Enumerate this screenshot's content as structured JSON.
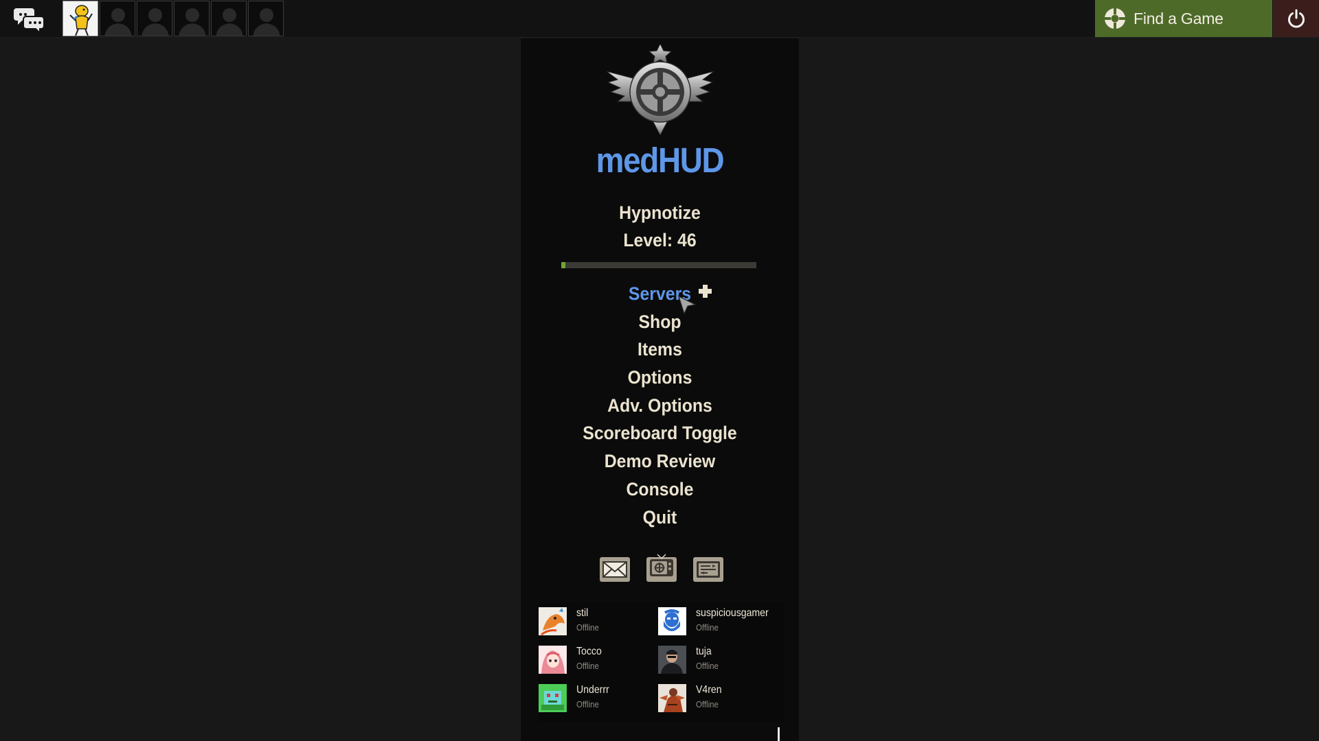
{
  "topbar": {
    "party_slots": [
      "self",
      "empty",
      "empty",
      "empty",
      "empty",
      "empty"
    ],
    "find_game_label": "Find a Game"
  },
  "menu": {
    "title": "medHUD",
    "player_name": "Hypnotize",
    "level_text": "Level: 46",
    "xp_progress": 0.02,
    "items": [
      "Servers",
      "Shop",
      "Items",
      "Options",
      "Adv. Options",
      "Scoreboard Toggle",
      "Demo Review",
      "Console",
      "Quit"
    ],
    "hovered_item": "Servers"
  },
  "bottom_icons": [
    "mail-icon",
    "tv-icon",
    "replay-icon"
  ],
  "friends": [
    {
      "name": "stil",
      "status": "Offline",
      "avatar": "orange-dragon"
    },
    {
      "name": "suspiciousgamer",
      "status": "Offline",
      "avatar": "blue-bearded-face"
    },
    {
      "name": "Tocco",
      "status": "Offline",
      "avatar": "pink-anime-girl"
    },
    {
      "name": "tuja",
      "status": "Offline",
      "avatar": "dark-soldier"
    },
    {
      "name": "Underrr",
      "status": "Offline",
      "avatar": "green-pixel-creature"
    },
    {
      "name": "V4ren",
      "status": "Offline",
      "avatar": "red-fighter"
    }
  ],
  "colors": {
    "accent_blue": "#5e97e8",
    "find_game_green": "#4e6a29",
    "power_red": "#3b1e1b",
    "menu_text": "#ebe3cf",
    "xp_fill": "#73a636"
  }
}
